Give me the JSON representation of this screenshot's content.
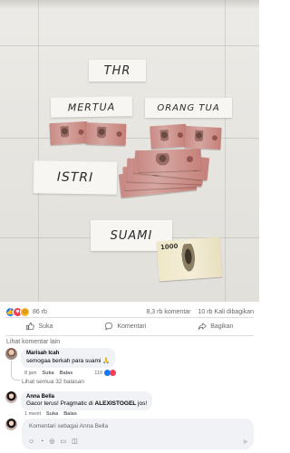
{
  "photo": {
    "cards": {
      "thr": "THR",
      "mertua": "MERTUA",
      "orang_tua": "ORANG TUA",
      "istri": "ISTRI",
      "suami": "SUAMI"
    },
    "note_value_small": "1000"
  },
  "stats": {
    "reaction_count": "86 rb",
    "comments": "8,3 rb komentar",
    "shares": "10 rb Kali dibagikan"
  },
  "actions": {
    "like": "Suka",
    "comment": "Komentari",
    "share": "Bagikan"
  },
  "comments": {
    "see_more": "Lihat komentar lain",
    "c1": {
      "name": "Marisah Icah",
      "text": "semogaa berkah para suami 🙏",
      "time": "8 jam",
      "like": "Suka",
      "reply": "Balas",
      "react_count": "110"
    },
    "see_replies": "Lihat semua 32 balasan",
    "c2": {
      "name": "Anna Bella",
      "text_prefix": "Gacor terus! Pragmatic di ",
      "text_bold": "ALEXISTOGEL",
      "text_suffix": " jos!",
      "time": "1 menit",
      "like": "Suka",
      "reply": "Balas"
    }
  },
  "composer": {
    "placeholder": "Komentari sebagai Anna Bella"
  },
  "colors": {
    "accent": "#1877f2",
    "love": "#f33e58",
    "haha": "#f7b125",
    "muted_text": "#65676b",
    "bubble_bg": "#f0f2f5"
  }
}
